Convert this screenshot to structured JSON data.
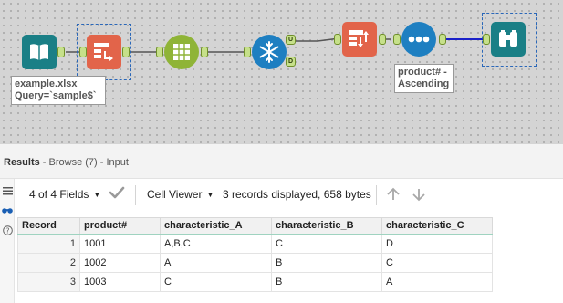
{
  "workflow": {
    "input_annotation": [
      "example.xlsx",
      "Query=`sample$`"
    ],
    "sort_annotation": [
      "product# -",
      "Ascending"
    ],
    "anchor_unique": "U",
    "anchor_duplicate": "D"
  },
  "colors": {
    "input": "#1a7f86",
    "select": "#e2644a",
    "summarize": "#8fb437",
    "unique": "#1e7fc1",
    "sort": "#e2644a",
    "sample": "#1e7fc1",
    "browse": "#1a7f86"
  },
  "results": {
    "title": "Results",
    "subtitle": " - Browse (7) - Input"
  },
  "toolbar": {
    "fields": "4 of 4 Fields",
    "viewer": "Cell Viewer",
    "status": "3 records displayed, 658 bytes"
  },
  "table": {
    "headers": [
      "Record",
      "product#",
      "characteristic_A",
      "characteristic_B",
      "characteristic_C"
    ],
    "rows": [
      [
        "1",
        "1001",
        "A,B,C",
        "C",
        "D"
      ],
      [
        "2",
        "1002",
        "A",
        "B",
        "C"
      ],
      [
        "3",
        "1003",
        "C",
        "B",
        "A"
      ]
    ]
  }
}
